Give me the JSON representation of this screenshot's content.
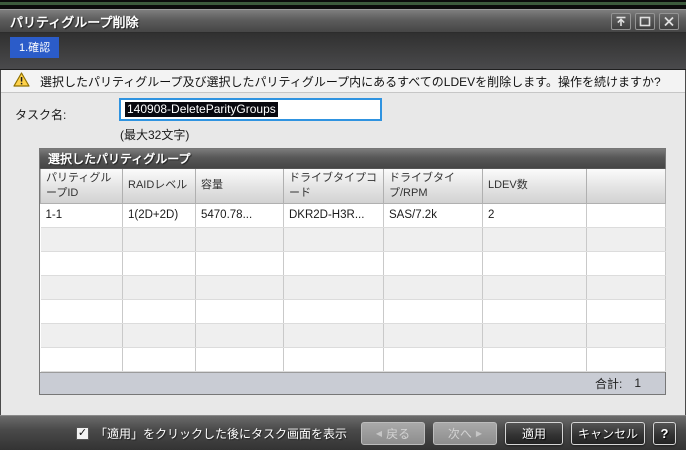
{
  "window": {
    "title": "パリティグループ削除"
  },
  "steps": {
    "current": "1.確認"
  },
  "warning": {
    "message": "選択したパリティグループ及び選択したパリティグループ内にあるすべてのLDEVを削除します。操作を続けますか?"
  },
  "task": {
    "label": "タスク名:",
    "value": "140908-DeleteParityGroups",
    "hint": "(最大32文字)"
  },
  "table": {
    "title": "選択したパリティグループ",
    "columns": [
      "パリティグループID",
      "RAIDレベル",
      "容量",
      "ドライブタイプコード",
      "ドライブタイプ/RPM",
      "LDEV数",
      ""
    ],
    "rows": [
      [
        "1-1",
        "1(2D+2D)",
        "5470.78...",
        "DKR2D-H3R...",
        "SAS/7.2k",
        "2",
        ""
      ]
    ],
    "footer": {
      "total_label": "合計:",
      "total_value": "1"
    }
  },
  "footer_bar": {
    "checkbox_checked": true,
    "checkbox_glyph": "✓",
    "checkbox_label": "「適用」をクリックした後にタスク画面を表示",
    "buttons": {
      "back_arrow": "◀",
      "back": "戻る",
      "next": "次へ",
      "next_arrow": "▶",
      "apply": "適用",
      "cancel": "キャンセル",
      "help": "?"
    }
  },
  "colors": {
    "accent_blue": "#2b5cc9",
    "input_focus_border": "#2f93e0",
    "selection_bg": "#08080f",
    "warning_yellow": "#ffd24a",
    "table_footer_bg": "#c9ccd4"
  }
}
